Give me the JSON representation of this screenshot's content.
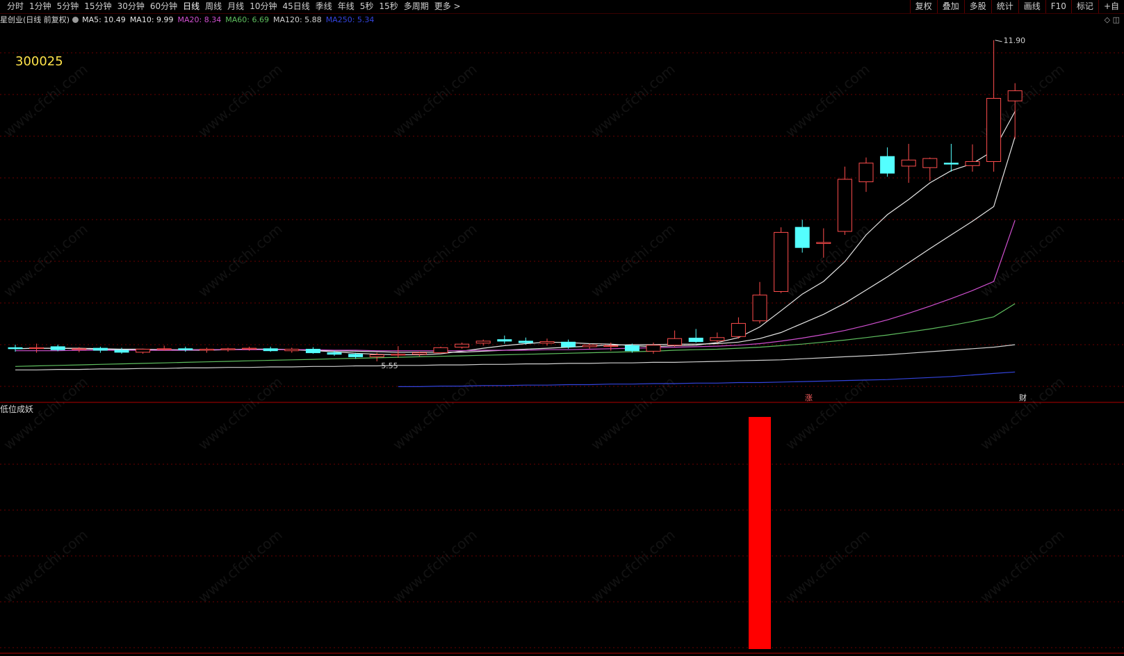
{
  "toolbar": {
    "period_tabs": [
      "分时",
      "1分钟",
      "5分钟",
      "15分钟",
      "30分钟",
      "60分钟",
      "日线",
      "周线",
      "月线",
      "10分钟",
      "45日线",
      "季线",
      "年线",
      "5秒",
      "15秒",
      "多周期",
      "更多 >"
    ],
    "active_tab": "日线",
    "right_tools": [
      "复权",
      "叠加",
      "多股",
      "统计",
      "画线",
      "F10",
      "标记",
      "+自"
    ]
  },
  "stock": {
    "title": "星创业(日线 前复权)",
    "code": "300025"
  },
  "legend": [
    {
      "label": "MA5: 10.49",
      "color": "#e6e6e6"
    },
    {
      "label": "MA10: 9.99",
      "color": "#e6e6e6"
    },
    {
      "label": "MA20: 8.34",
      "color": "#d050d0"
    },
    {
      "label": "MA60: 6.69",
      "color": "#5fbf5f"
    },
    {
      "label": "MA120: 5.88",
      "color": "#d0d0d0"
    },
    {
      "label": "MA250: 5.34",
      "color": "#3344dd"
    }
  ],
  "annotations": {
    "high_label": "11.90",
    "low_label": "5.55",
    "marker_zhang": "涨",
    "marker_cai": "财"
  },
  "indicator": {
    "title": "低位成妖"
  },
  "watermark": "www.cfchi.com",
  "colors": {
    "up": "#ff4d4d",
    "down": "#54ffff",
    "grid": "#6b0000",
    "divider": "#b00000",
    "signal": "#ff0000"
  },
  "chart_data": {
    "type": "candlestick",
    "price_scale": [
      5.0,
      12.2
    ],
    "candles": [
      {
        "o": 5.82,
        "h": 5.88,
        "l": 5.74,
        "c": 5.8
      },
      {
        "o": 5.81,
        "h": 5.9,
        "l": 5.72,
        "c": 5.82
      },
      {
        "o": 5.84,
        "h": 5.88,
        "l": 5.75,
        "c": 5.78
      },
      {
        "o": 5.79,
        "h": 5.83,
        "l": 5.73,
        "c": 5.8
      },
      {
        "o": 5.81,
        "h": 5.84,
        "l": 5.72,
        "c": 5.77
      },
      {
        "o": 5.77,
        "h": 5.82,
        "l": 5.7,
        "c": 5.73
      },
      {
        "o": 5.73,
        "h": 5.8,
        "l": 5.7,
        "c": 5.79
      },
      {
        "o": 5.79,
        "h": 5.86,
        "l": 5.76,
        "c": 5.8
      },
      {
        "o": 5.8,
        "h": 5.84,
        "l": 5.74,
        "c": 5.78
      },
      {
        "o": 5.77,
        "h": 5.82,
        "l": 5.72,
        "c": 5.79
      },
      {
        "o": 5.78,
        "h": 5.82,
        "l": 5.74,
        "c": 5.8
      },
      {
        "o": 5.8,
        "h": 5.84,
        "l": 5.76,
        "c": 5.81
      },
      {
        "o": 5.8,
        "h": 5.84,
        "l": 5.74,
        "c": 5.76
      },
      {
        "o": 5.76,
        "h": 5.82,
        "l": 5.72,
        "c": 5.79
      },
      {
        "o": 5.79,
        "h": 5.83,
        "l": 5.7,
        "c": 5.72
      },
      {
        "o": 5.72,
        "h": 5.76,
        "l": 5.66,
        "c": 5.69
      },
      {
        "o": 5.69,
        "h": 5.72,
        "l": 5.6,
        "c": 5.64
      },
      {
        "o": 5.64,
        "h": 5.72,
        "l": 5.55,
        "c": 5.68
      },
      {
        "o": 5.68,
        "h": 5.85,
        "l": 5.62,
        "c": 5.69
      },
      {
        "o": 5.69,
        "h": 5.74,
        "l": 5.65,
        "c": 5.72
      },
      {
        "o": 5.72,
        "h": 5.84,
        "l": 5.7,
        "c": 5.82
      },
      {
        "o": 5.83,
        "h": 5.92,
        "l": 5.8,
        "c": 5.89
      },
      {
        "o": 5.91,
        "h": 5.98,
        "l": 5.86,
        "c": 5.95
      },
      {
        "o": 5.98,
        "h": 6.06,
        "l": 5.9,
        "c": 5.95
      },
      {
        "o": 5.95,
        "h": 6.02,
        "l": 5.88,
        "c": 5.92
      },
      {
        "o": 5.91,
        "h": 6.0,
        "l": 5.86,
        "c": 5.94
      },
      {
        "o": 5.93,
        "h": 5.98,
        "l": 5.8,
        "c": 5.84
      },
      {
        "o": 5.84,
        "h": 5.9,
        "l": 5.8,
        "c": 5.87
      },
      {
        "o": 5.86,
        "h": 5.92,
        "l": 5.76,
        "c": 5.86
      },
      {
        "o": 5.86,
        "h": 5.9,
        "l": 5.72,
        "c": 5.76
      },
      {
        "o": 5.75,
        "h": 5.92,
        "l": 5.7,
        "c": 5.87
      },
      {
        "o": 5.87,
        "h": 6.16,
        "l": 5.84,
        "c": 6.0
      },
      {
        "o": 6.01,
        "h": 6.19,
        "l": 5.92,
        "c": 5.94
      },
      {
        "o": 5.96,
        "h": 6.12,
        "l": 5.92,
        "c": 6.02
      },
      {
        "o": 6.04,
        "h": 6.42,
        "l": 6.0,
        "c": 6.3
      },
      {
        "o": 6.35,
        "h": 7.12,
        "l": 6.3,
        "c": 6.86
      },
      {
        "o": 6.93,
        "h": 8.2,
        "l": 6.9,
        "c": 8.1
      },
      {
        "o": 8.2,
        "h": 8.35,
        "l": 7.7,
        "c": 7.8
      },
      {
        "o": 7.88,
        "h": 8.18,
        "l": 7.6,
        "c": 7.9
      },
      {
        "o": 8.12,
        "h": 9.4,
        "l": 8.05,
        "c": 9.15
      },
      {
        "o": 9.1,
        "h": 9.58,
        "l": 8.9,
        "c": 9.47
      },
      {
        "o": 9.6,
        "h": 9.78,
        "l": 9.2,
        "c": 9.27
      },
      {
        "o": 9.41,
        "h": 9.85,
        "l": 9.08,
        "c": 9.53
      },
      {
        "o": 9.38,
        "h": 9.58,
        "l": 9.12,
        "c": 9.56
      },
      {
        "o": 9.47,
        "h": 9.85,
        "l": 9.3,
        "c": 9.45
      },
      {
        "o": 9.42,
        "h": 9.84,
        "l": 9.3,
        "c": 9.5
      },
      {
        "o": 9.5,
        "h": 11.9,
        "l": 9.3,
        "c": 10.75
      },
      {
        "o": 10.7,
        "h": 11.05,
        "l": 9.95,
        "c": 10.9
      }
    ],
    "moving_averages": [
      {
        "name": "MA5",
        "values": [
          5.8,
          5.81,
          5.81,
          5.8,
          5.79,
          5.78,
          5.77,
          5.77,
          5.77,
          5.77,
          5.78,
          5.79,
          5.79,
          5.78,
          5.76,
          5.74,
          5.71,
          5.69,
          5.68,
          5.68,
          5.7,
          5.75,
          5.81,
          5.86,
          5.9,
          5.93,
          5.92,
          5.9,
          5.89,
          5.86,
          5.84,
          5.86,
          5.87,
          5.92,
          6.02,
          6.23,
          6.55,
          6.88,
          7.13,
          7.52,
          8.05,
          8.45,
          8.75,
          9.08,
          9.32,
          9.46,
          9.72,
          10.49
        ]
      },
      {
        "name": "MA10",
        "values": [
          5.8,
          5.81,
          5.81,
          5.81,
          5.8,
          5.79,
          5.79,
          5.78,
          5.78,
          5.78,
          5.78,
          5.79,
          5.79,
          5.78,
          5.77,
          5.76,
          5.75,
          5.74,
          5.73,
          5.73,
          5.73,
          5.73,
          5.75,
          5.77,
          5.79,
          5.81,
          5.83,
          5.85,
          5.87,
          5.88,
          5.88,
          5.89,
          5.89,
          5.9,
          5.93,
          6.0,
          6.12,
          6.3,
          6.48,
          6.7,
          6.96,
          7.22,
          7.5,
          7.78,
          8.05,
          8.32,
          8.61,
          9.99
        ]
      },
      {
        "name": "MA20",
        "values": [
          5.76,
          5.76,
          5.76,
          5.77,
          5.77,
          5.77,
          5.77,
          5.77,
          5.77,
          5.78,
          5.78,
          5.78,
          5.78,
          5.78,
          5.78,
          5.77,
          5.77,
          5.76,
          5.76,
          5.76,
          5.76,
          5.76,
          5.77,
          5.77,
          5.77,
          5.78,
          5.78,
          5.79,
          5.8,
          5.81,
          5.82,
          5.83,
          5.84,
          5.85,
          5.87,
          5.9,
          5.95,
          6.01,
          6.08,
          6.16,
          6.26,
          6.37,
          6.5,
          6.64,
          6.79,
          6.95,
          7.13,
          8.34
        ]
      },
      {
        "name": "MA60",
        "values": [
          5.45,
          5.46,
          5.47,
          5.48,
          5.49,
          5.5,
          5.51,
          5.52,
          5.53,
          5.54,
          5.55,
          5.56,
          5.57,
          5.58,
          5.59,
          5.6,
          5.61,
          5.62,
          5.63,
          5.64,
          5.65,
          5.66,
          5.67,
          5.68,
          5.69,
          5.7,
          5.71,
          5.72,
          5.73,
          5.74,
          5.75,
          5.77,
          5.78,
          5.79,
          5.81,
          5.83,
          5.86,
          5.89,
          5.93,
          5.97,
          6.02,
          6.07,
          6.13,
          6.19,
          6.26,
          6.34,
          6.43,
          6.69
        ]
      },
      {
        "name": "MA120",
        "values": [
          5.38,
          5.38,
          5.39,
          5.39,
          5.4,
          5.4,
          5.41,
          5.41,
          5.42,
          5.42,
          5.43,
          5.43,
          5.44,
          5.44,
          5.45,
          5.45,
          5.46,
          5.46,
          5.47,
          5.47,
          5.48,
          5.48,
          5.49,
          5.49,
          5.5,
          5.5,
          5.51,
          5.51,
          5.52,
          5.52,
          5.53,
          5.53,
          5.54,
          5.55,
          5.56,
          5.57,
          5.58,
          5.6,
          5.62,
          5.64,
          5.66,
          5.68,
          5.71,
          5.74,
          5.77,
          5.8,
          5.83,
          5.88
        ]
      },
      {
        "name": "MA250",
        "values": [
          null,
          null,
          null,
          null,
          null,
          null,
          null,
          null,
          null,
          null,
          null,
          null,
          null,
          null,
          null,
          null,
          null,
          null,
          5.05,
          5.05,
          5.06,
          5.06,
          5.07,
          5.07,
          5.08,
          5.08,
          5.09,
          5.09,
          5.1,
          5.1,
          5.11,
          5.11,
          5.12,
          5.12,
          5.13,
          5.13,
          5.14,
          5.15,
          5.16,
          5.17,
          5.18,
          5.19,
          5.21,
          5.23,
          5.25,
          5.28,
          5.31,
          5.34
        ]
      }
    ],
    "signal": {
      "index": 35,
      "value": 1
    }
  }
}
